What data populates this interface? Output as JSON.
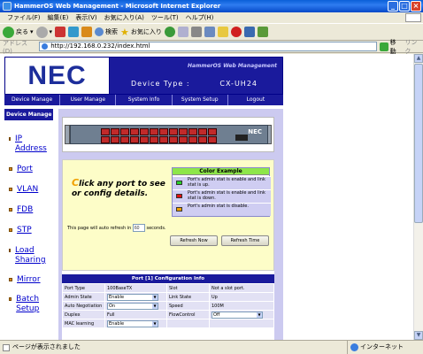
{
  "window": {
    "title": "HammerOS Web Management - Microsoft Internet Explorer"
  },
  "menu": [
    "ファイル(F)",
    "編集(E)",
    "表示(V)",
    "お気に入り(A)",
    "ツール(T)",
    "ヘルプ(H)"
  ],
  "toolbar": {
    "back": "戻る",
    "search": "検索",
    "favorites": "お気に入り"
  },
  "address": {
    "label": "アドレス(D)",
    "url": "http://192.168.0.232/index.html",
    "go": "移動",
    "links": "リンク"
  },
  "banner": {
    "logo": "NEC",
    "product": "HammerOS Web Management",
    "device_type_label": "Device Type :",
    "device_type_value": "CX-UH24"
  },
  "nav": [
    "Device Manage",
    "User Manage",
    "System Info",
    "System Setup",
    "Logout"
  ],
  "sidebar": {
    "header": "Device Manage",
    "items": [
      "IP Address",
      "Port",
      "VLAN",
      "FDB",
      "STP",
      "Load Sharing",
      "Mirror",
      "Batch Setup"
    ]
  },
  "switch_logo": "NEC",
  "prompt": {
    "first_letter": "C",
    "rest": "lick any port to see or config details."
  },
  "legend": {
    "title": "Color Example",
    "rows": [
      {
        "text": "Port's admin stat is enable and link stat is up.",
        "color": "#2bd12b"
      },
      {
        "text": "Port's admin stat is enable and link stat is down.",
        "color": "#e01010"
      },
      {
        "text": "Port's admin stat is disable.",
        "color": "#f0a000"
      }
    ]
  },
  "refresh": {
    "prefix": "This page will auto refresh in",
    "seconds": "60",
    "suffix": "seconds.",
    "refresh_now": "Refresh Now",
    "refresh_time": "Refresh Time"
  },
  "config": {
    "title": "Port [1] Configuration Info",
    "rows": [
      {
        "k1": "Port Type",
        "v1": "100BaseTX",
        "k2": "Slot",
        "v2": "Not a slot port."
      },
      {
        "k1": "Admin State",
        "v1": "Enable",
        "k2": "Link State",
        "v2": "Up"
      },
      {
        "k1": "Auto Negotiation",
        "v1": "On",
        "k2": "Speed",
        "v2": "100M"
      },
      {
        "k1": "Duplex",
        "v1": "Full",
        "k2": "FlowControl",
        "v2": "Off"
      },
      {
        "k1": "MAC learning",
        "v1": "Enable",
        "k2": "",
        "v2": ""
      }
    ]
  },
  "status": {
    "left": "ページが表示されました",
    "zone": "インターネット"
  }
}
